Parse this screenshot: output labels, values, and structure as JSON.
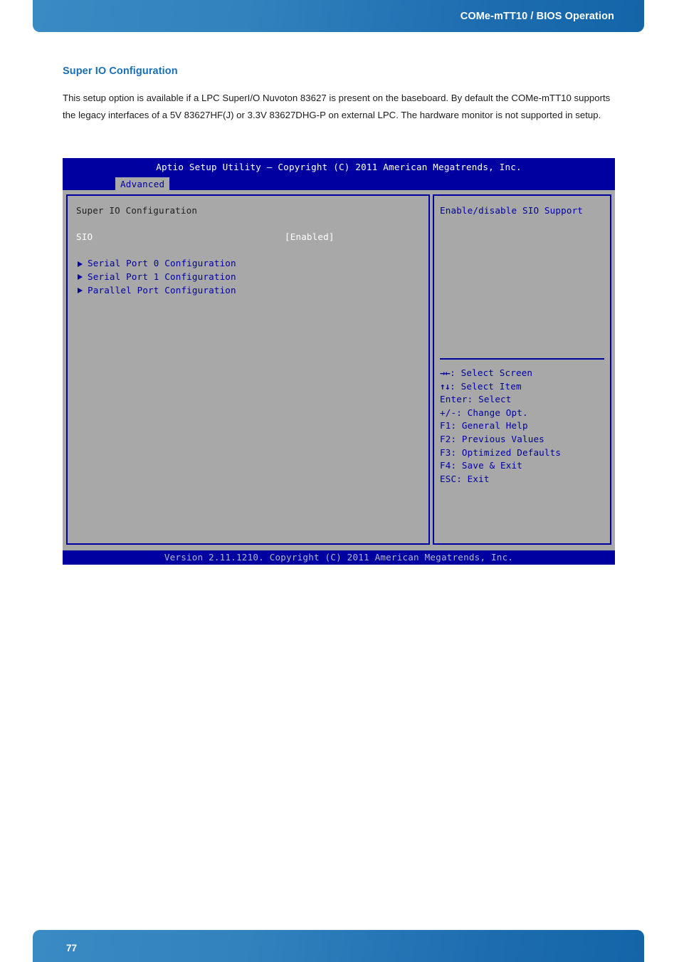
{
  "page": {
    "header_title": "COMe-mTT10 / BIOS Operation",
    "page_number": "77",
    "accent_color": "#1a6fb5",
    "header_gradient_from": "#3a8ac4",
    "header_gradient_to": "#1364a8"
  },
  "section": {
    "heading": "Super IO Configuration",
    "paragraph": "This setup option is available if a LPC SuperI/O Nuvoton 83627 is present on the baseboard. By default the COMe-mTT10 supports the legacy interfaces of a 5V 83627HF(J) or 3.3V 83627DHG-P on external LPC. The hardware monitor is not supported in setup."
  },
  "bios": {
    "title": "Aptio Setup Utility – Copyright (C) 2011 American Megatrends, Inc.",
    "active_tab": "Advanced",
    "footer": "Version 2.11.1210. Copyright (C) 2011 American Megatrends, Inc.",
    "colors": {
      "titlebar_bg": "#0000a0",
      "panel_bg": "#a8a8a8",
      "border": "#0000a0",
      "highlight_text": "#ffffff",
      "link_text": "#0000a0"
    },
    "left_panel": {
      "section_title": "Super IO Configuration",
      "option": {
        "label": "SIO",
        "value": "[Enabled]"
      },
      "submenus": [
        {
          "label": "Serial Port 0 Configuration"
        },
        {
          "label": "Serial Port 1 Configuration"
        },
        {
          "label": "Parallel Port Configuration"
        }
      ]
    },
    "right_panel": {
      "help_text": "Enable/disable SIO Support",
      "keys": [
        {
          "glyph": "→←",
          "text": ": Select Screen"
        },
        {
          "glyph": "↑↓",
          "text": ": Select Item"
        },
        {
          "glyph": "",
          "text": "Enter: Select"
        },
        {
          "glyph": "",
          "text": "+/-: Change Opt."
        },
        {
          "glyph": "",
          "text": "F1: General Help"
        },
        {
          "glyph": "",
          "text": "F2: Previous Values"
        },
        {
          "glyph": "",
          "text": "F3: Optimized Defaults"
        },
        {
          "glyph": "",
          "text": "F4: Save & Exit"
        },
        {
          "glyph": "",
          "text": "ESC: Exit"
        }
      ]
    }
  }
}
